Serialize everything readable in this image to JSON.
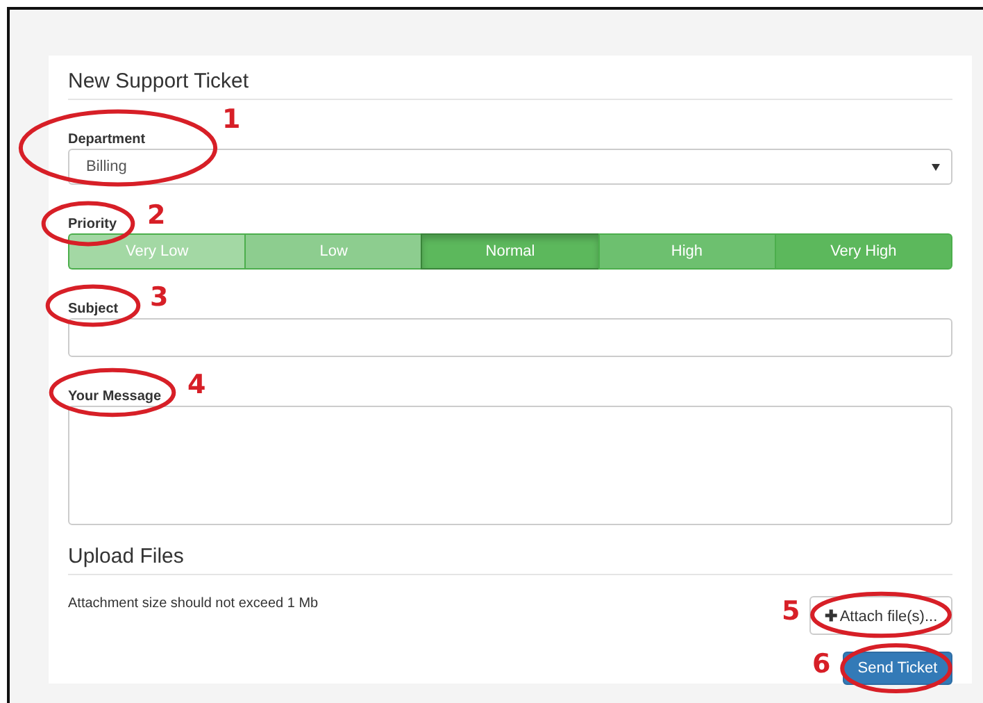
{
  "title": "New Support Ticket",
  "department": {
    "label": "Department",
    "value": "Billing",
    "callout": "1"
  },
  "priority": {
    "label": "Priority",
    "callout": "2",
    "options": [
      {
        "label": "Very Low",
        "color": "#a3d8a4",
        "selected": false
      },
      {
        "label": "Low",
        "color": "#8dcd8f",
        "selected": false
      },
      {
        "label": "Normal",
        "color": "#5cb85c",
        "selected": true
      },
      {
        "label": "High",
        "color": "#6dc06f",
        "selected": false
      },
      {
        "label": "Very High",
        "color": "#5cb85c",
        "selected": false
      }
    ]
  },
  "subject": {
    "label": "Subject",
    "callout": "3"
  },
  "message": {
    "label": "Your Message",
    "callout": "4"
  },
  "upload": {
    "title": "Upload Files",
    "note": "Attachment size should not exceed 1 Mb",
    "attach_button": {
      "icon": "✚",
      "label": "Attach file(s)...",
      "callout": "5"
    }
  },
  "send_button": {
    "label": "Send Ticket",
    "callout": "6"
  }
}
